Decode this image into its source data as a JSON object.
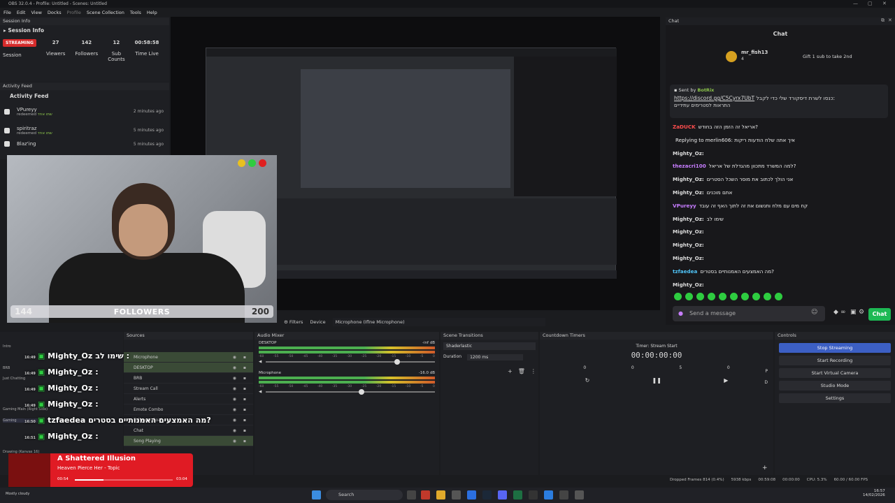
{
  "window": {
    "title": "OBS 32.0.4 - Profile: Untitled - Scenes: Untitled"
  },
  "menu": [
    "File",
    "Edit",
    "View",
    "Docks",
    "Profile",
    "Scene Collection",
    "Tools",
    "Help"
  ],
  "session": {
    "panel_title": "Session Info",
    "heading": "Session Info",
    "badge": "STREAMING",
    "badge_sub": "Session",
    "viewers": "27",
    "viewers_label": "Viewers",
    "followers": "142",
    "followers_label": "Followers",
    "subs": "12",
    "subs_label": "Sub Counts",
    "time": "00:58:58",
    "time_label": "Time Live"
  },
  "activity": {
    "panel_title": "Activity Feed",
    "heading": "Activity Feed",
    "items": [
      {
        "user": "VPureyy",
        "action": "redeemed",
        "reward": "שתו אחד",
        "time": "2 minutes ago"
      },
      {
        "user": "spiritraz",
        "action": "redeemed",
        "reward": "שתו אחד",
        "time": "5 minutes ago"
      },
      {
        "user": "Blaz'ing",
        "action": "",
        "reward": "",
        "time": "5 minutes ago"
      }
    ]
  },
  "webcam": {
    "followers_current": "144",
    "followers_label": "FOLLOWERS",
    "followers_goal": "200"
  },
  "chat": {
    "panel_title": "Chat",
    "heading": "Chat",
    "gift_user": "mr_fish13",
    "gift_text": "Gift 1 sub to take 2nd",
    "gift_count": "4",
    "pinned_by": "Sent by",
    "pinned_bot": "BotRix",
    "pinned_link": "https://discord.gg/C5Cyrx7UbT",
    "pinned_text_1": "כנסו לשרת דיסקורד שלי כדי לקבל:",
    "pinned_text_2": "התראות לסטרימים עתידיים",
    "messages": [
      {
        "user": "ZaDUCK",
        "text": "אריאל זה הזמן הזה בחודש?",
        "color": "#ff4d4d"
      },
      {
        "user": "",
        "text": "Replying to merlin606: איך אתה שלח הודעות ריקות",
        "color": "#888"
      },
      {
        "user": "Mighty_Oz:",
        "text": "",
        "color": "#ddd"
      },
      {
        "user": "thezacri100",
        "text": "למה המשרד מתכוון מהגדלת של אריאל?",
        "color": "#c77dff"
      },
      {
        "user": "Mighty_Oz:",
        "text": "אני הולך לכתוב את מוסר השכל הסטרים",
        "color": "#ddd"
      },
      {
        "user": "Mighty_Oz:",
        "text": "אתם מוכנים",
        "color": "#ddd"
      },
      {
        "user": "VPureyy",
        "text": "קח מים עם מלח ותנשום את זה לתוך האף זה עובד",
        "color": "#c77dff"
      },
      {
        "user": "Mighty_Oz:",
        "text": "שימו לב",
        "color": "#ddd"
      },
      {
        "user": "Mighty_Oz:",
        "text": "",
        "color": "#ddd"
      },
      {
        "user": "Mighty_Oz:",
        "text": "",
        "color": "#ddd"
      },
      {
        "user": "Mighty_Oz:",
        "text": "",
        "color": "#ddd"
      },
      {
        "user": "tzfaedea",
        "text": "מה האמצעים האמנותיים בסטרים?",
        "color": "#4fc3f7"
      },
      {
        "user": "Mighty_Oz:",
        "text": "",
        "color": "#ddd"
      }
    ],
    "input_placeholder": "Send a message",
    "send_label": "Chat"
  },
  "preview_bar": {
    "filters": "Filters",
    "device": "Device",
    "device_value": "Microphone (Iflne Microphone)"
  },
  "sources": {
    "panel_title": "Sources",
    "items": [
      "Microphone",
      "DESKTOP",
      "BRB",
      "Stream Call",
      "Alerts",
      "Emote Combo",
      "Follower Goal",
      "Chat",
      "Song Playing"
    ]
  },
  "overlay_chat": [
    {
      "time": "16:49",
      "user": "Mighty_Oz",
      "text": "שימו לב :"
    },
    {
      "time": "16:49",
      "user": "Mighty_Oz",
      "text": ":"
    },
    {
      "time": "16:49",
      "user": "Mighty_Oz",
      "text": ":"
    },
    {
      "time": "16:49",
      "user": "Mighty_Oz",
      "text": ":"
    },
    {
      "time": "16:50",
      "user": "tzfaedea",
      "text": "מה האמצעים האמנותיים בסטרים?"
    },
    {
      "time": "16:51",
      "user": "Mighty_Oz",
      "text": ":"
    }
  ],
  "scenes": {
    "labels": [
      "Intro",
      "BRB",
      "Just Chatting",
      "Gaming Main (Right Side)",
      "Gaming",
      "Drawing (Kanvas 16)"
    ]
  },
  "music": {
    "title": "A Shattered Illusion",
    "artist": "Heaven Pierce Her - Topic",
    "elapsed": "00:54",
    "duration": "03:04"
  },
  "audio": {
    "panel_title": "Audio Mixer",
    "ch1": "DESKTOP",
    "ch1_db": "-inf dB",
    "ch2": "Microphone",
    "ch2_db": "-16.0 dB",
    "ticks": [
      "-60",
      "-55",
      "-50",
      "-45",
      "-40",
      "-35",
      "-30",
      "-25",
      "-20",
      "-15",
      "-10",
      "-5",
      "0"
    ]
  },
  "transitions": {
    "panel_title": "Scene Transitions",
    "selected": "Shaderlastic",
    "duration_label": "Duration",
    "duration_value": "1200 ms"
  },
  "countdown": {
    "panel_title": "Countdown Timers",
    "timer_name": "Timer: Stream Start",
    "display": "00:00:00:00",
    "f1": "0",
    "f2": "0",
    "f3": "5",
    "f4": "0",
    "p": "P",
    "d": "D"
  },
  "controls": {
    "panel_title": "Controls",
    "buttons": [
      "Stop Streaming",
      "Start Recording",
      "Start Virtual Camera",
      "Studio Mode",
      "Settings"
    ]
  },
  "status": {
    "dropped": "Dropped Frames 814 (0.4%)",
    "kbps": "5938 kbps",
    "time1": "00:59:08",
    "time2": "00:00:00",
    "cpu": "CPU: 5.3%",
    "fps": "60.00 / 60.00 FPS"
  },
  "taskbar": {
    "search": "Search",
    "weather": "Mostly cloudy",
    "clock": "16:57",
    "date": "14/02/2026"
  }
}
